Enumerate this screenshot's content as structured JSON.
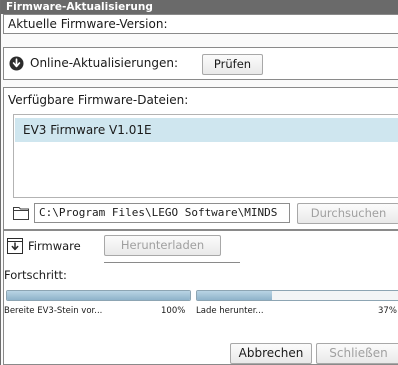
{
  "window": {
    "title": "Firmware-Aktualisierung"
  },
  "current_version": {
    "label": "Aktuelle Firmware-Version:"
  },
  "online_updates": {
    "label": "Online-Aktualisierungen:",
    "check_button": "Prüfen",
    "icon": "download-arrow-icon"
  },
  "files": {
    "label": "Verfügbare Firmware-Dateien:",
    "items": [
      "EV3 Firmware V1.01E"
    ],
    "selected_index": 0
  },
  "browse": {
    "path": "C:\\Program Files\\LEGO Software\\MINDS",
    "button": "Durchsuchen",
    "icon": "folder-icon"
  },
  "firmware_tab": {
    "label": "Firmware",
    "download_button": "Herunterladen",
    "icon": "firmware-icon"
  },
  "progress": {
    "label": "Fortschritt:",
    "items": [
      {
        "caption": "Bereite EV3-Stein vor...",
        "percent_label": "100%",
        "fraction": 1.0
      },
      {
        "caption": "Lade herunter...",
        "percent_label": "37%",
        "fraction": 0.37
      }
    ]
  },
  "footer": {
    "cancel_button": "Abbrechen",
    "close_button": "Schließen"
  },
  "colors": {
    "titlebar": "#6a6a6a",
    "selection": "#cfe6ef",
    "progress_fill": "#9fc0d5"
  }
}
